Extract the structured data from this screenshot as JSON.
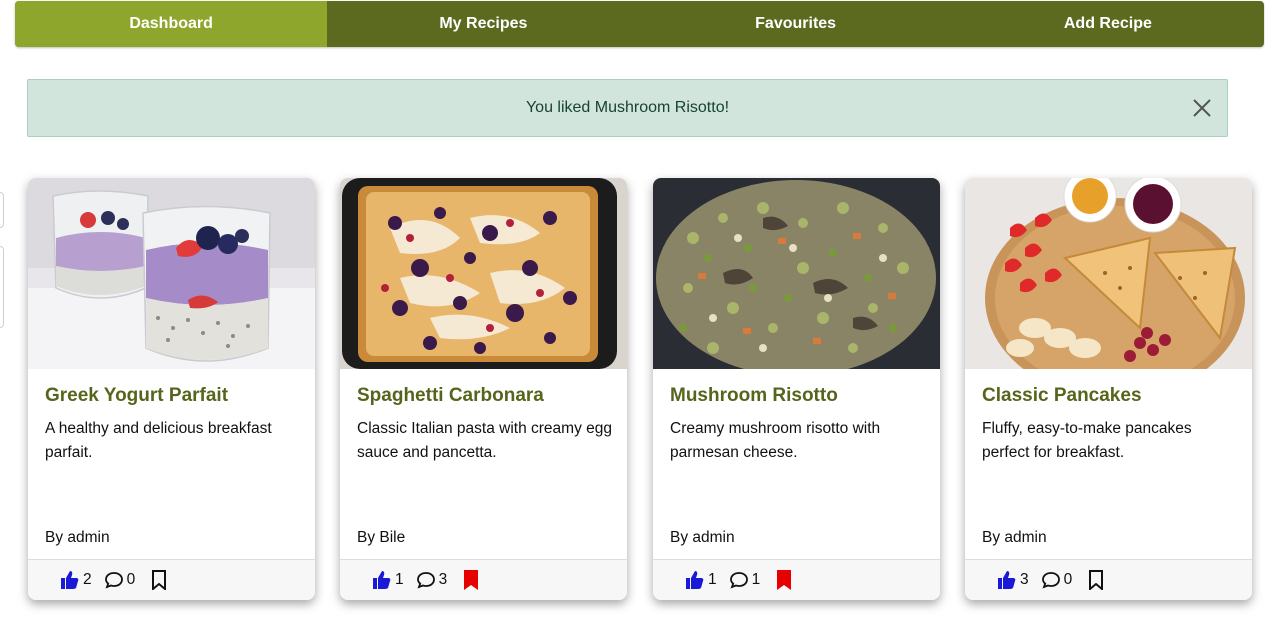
{
  "nav": {
    "tabs": [
      {
        "label": "Dashboard",
        "active": true
      },
      {
        "label": "My Recipes",
        "active": false
      },
      {
        "label": "Favourites",
        "active": false
      },
      {
        "label": "Add Recipe",
        "active": false
      }
    ]
  },
  "alert": {
    "message": "You liked Mushroom Risotto!",
    "close_icon": "close-icon"
  },
  "colors": {
    "nav_bg": "#5b6a1f",
    "nav_active": "#8ea62c",
    "title": "#56651c",
    "like": "#1a1ad6",
    "bookmark_saved": "#e60000",
    "alert_bg": "#d2e5dd"
  },
  "recipes": [
    {
      "title": "Greek Yogurt Parfait",
      "description": "A healthy and delicious breakfast parfait.",
      "author": "By admin",
      "likes": "2",
      "comments": "0",
      "bookmarked": false,
      "image": "yogurt-parfait-photo"
    },
    {
      "title": "Spaghetti Carbonara",
      "description": "Classic Italian pasta with creamy egg sauce and pancetta.",
      "author": "By Bile",
      "likes": "1",
      "comments": "3",
      "bookmarked": true,
      "image": "berry-cake-photo"
    },
    {
      "title": "Mushroom Risotto",
      "description": "Creamy mushroom risotto with parmesan cheese.",
      "author": "By admin",
      "likes": "1",
      "comments": "1",
      "bookmarked": true,
      "image": "risotto-photo"
    },
    {
      "title": "Classic Pancakes",
      "description": "Fluffy, easy-to-make pancakes perfect for breakfast.",
      "author": "By admin",
      "likes": "3",
      "comments": "0",
      "bookmarked": false,
      "image": "pancakes-photo"
    }
  ]
}
